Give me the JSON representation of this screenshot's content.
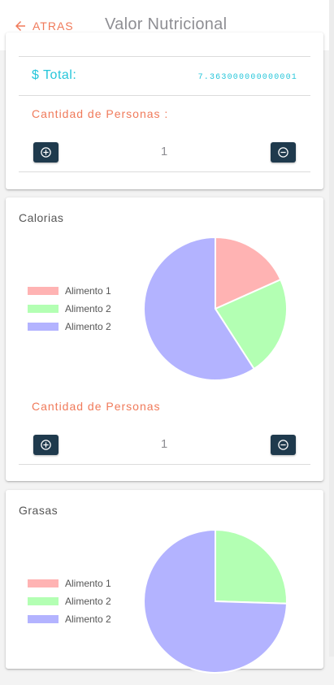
{
  "header": {
    "back_label": "ATRAS",
    "title": "Valor Nutricional"
  },
  "summary": {
    "total_label": "$ Total:",
    "total_value": "7.363000000000001",
    "cantidad_label": "Cantidad de Personas :",
    "count": "1"
  },
  "calorias": {
    "title": "Calorias",
    "cantidad_label": "Cantidad de Personas",
    "count": "1",
    "chart_data": {
      "type": "pie",
      "labels": [
        "Alimento 1",
        "Alimento 2",
        "Alimento 2"
      ],
      "values": [
        18.3,
        22.6,
        59.1
      ],
      "colors": [
        "#ffb3b3",
        "#b3ffb3",
        "#b3b3ff"
      ]
    }
  },
  "grasas": {
    "title": "Grasas",
    "chart_data": {
      "type": "pie",
      "labels": [
        "Alimento 1",
        "Alimento 2",
        "Alimento 2"
      ],
      "values": [
        0,
        25.5,
        74.5
      ],
      "colors": [
        "#ffb3b3",
        "#b3ffb3",
        "#b3b3ff"
      ]
    }
  },
  "colors": {
    "accent": "#f07a5a",
    "teal": "#26c6da",
    "button": "#1f3a4d"
  },
  "icons": {
    "back": "arrow-left-icon",
    "plus": "plus-circle-icon",
    "minus": "minus-circle-icon"
  }
}
